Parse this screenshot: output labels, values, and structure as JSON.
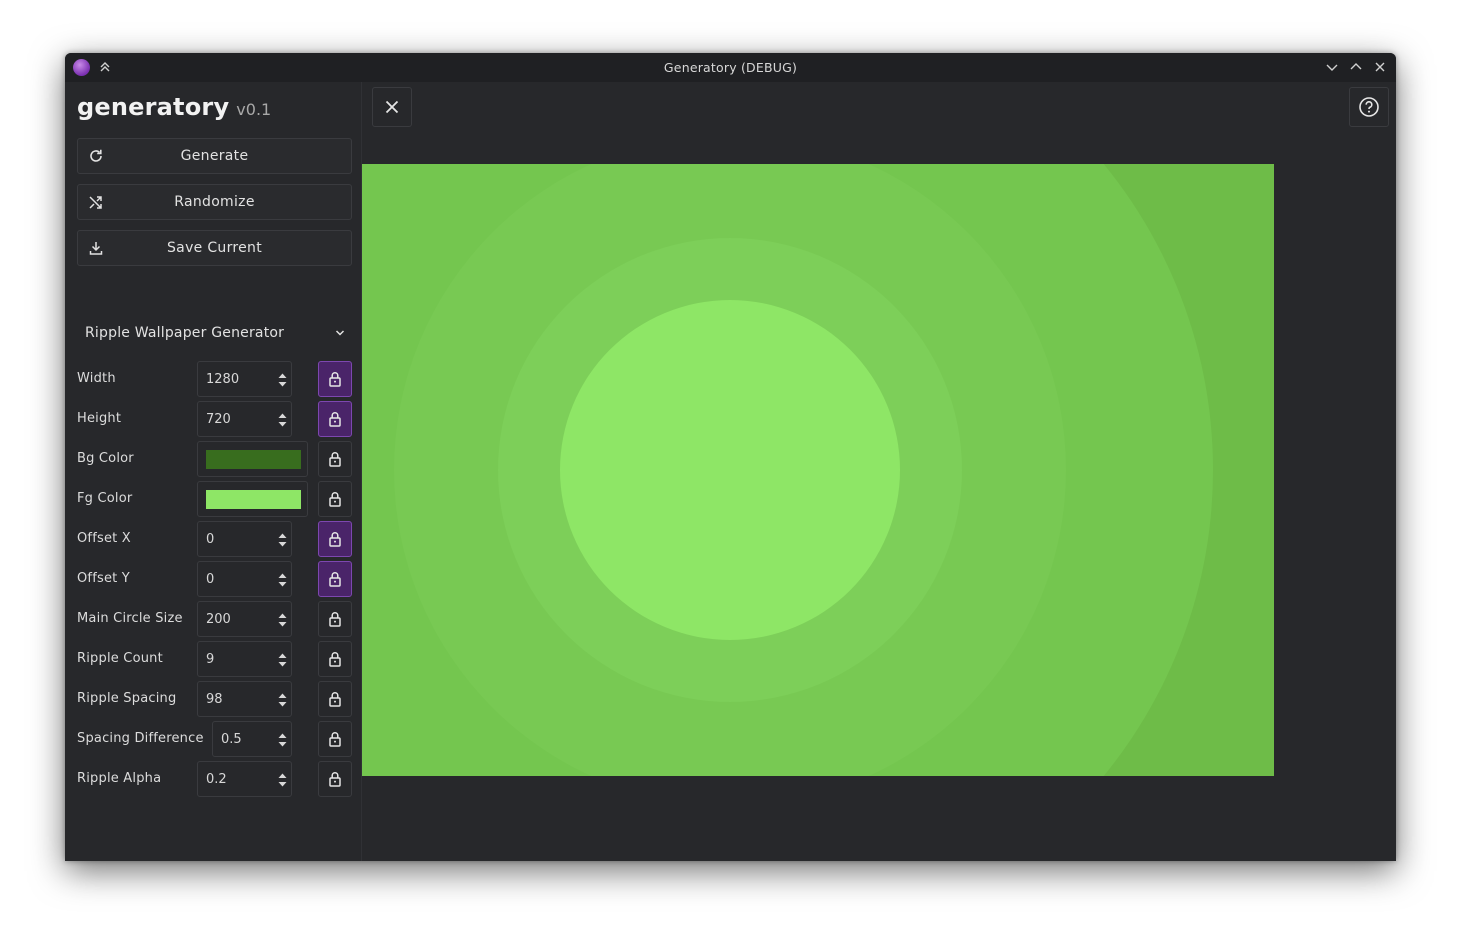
{
  "window": {
    "title": "Generatory (DEBUG)"
  },
  "brand": {
    "name": "generatory",
    "version": "v0.1"
  },
  "actions": [
    {
      "label": "Generate",
      "icon": "refresh-icon"
    },
    {
      "label": "Randomize",
      "icon": "shuffle-icon"
    },
    {
      "label": "Save Current",
      "icon": "download-icon"
    }
  ],
  "generator": {
    "selected": "Ripple Wallpaper Generator"
  },
  "params": {
    "width": {
      "label": "Width",
      "value": "1280",
      "locked": true
    },
    "height": {
      "label": "Height",
      "value": "720",
      "locked": true
    },
    "bg_color": {
      "label": "Bg Color",
      "color": "#386d1e",
      "locked": false
    },
    "fg_color": {
      "label": "Fg Color",
      "color": "#8ee666",
      "locked": false
    },
    "offset_x": {
      "label": "Offset X",
      "value": "0",
      "locked": true
    },
    "offset_y": {
      "label": "Offset Y",
      "value": "0",
      "locked": true
    },
    "main_circle_size": {
      "label": "Main Circle Size",
      "value": "200",
      "locked": false
    },
    "ripple_count": {
      "label": "Ripple Count",
      "value": "9",
      "locked": false
    },
    "ripple_spacing": {
      "label": "Ripple Spacing",
      "value": "98",
      "locked": false
    },
    "spacing_difference": {
      "label": "Spacing Difference",
      "value": "0.5",
      "locked": false
    },
    "ripple_alpha": {
      "label": "Ripple Alpha",
      "value": "0.2",
      "locked": false
    }
  },
  "colors": {
    "accent": "#4a2469",
    "preview_ring_colors": [
      "#6ebc48",
      "#74c64f",
      "#78c953",
      "#7dcf59",
      "#8ee666"
    ]
  }
}
